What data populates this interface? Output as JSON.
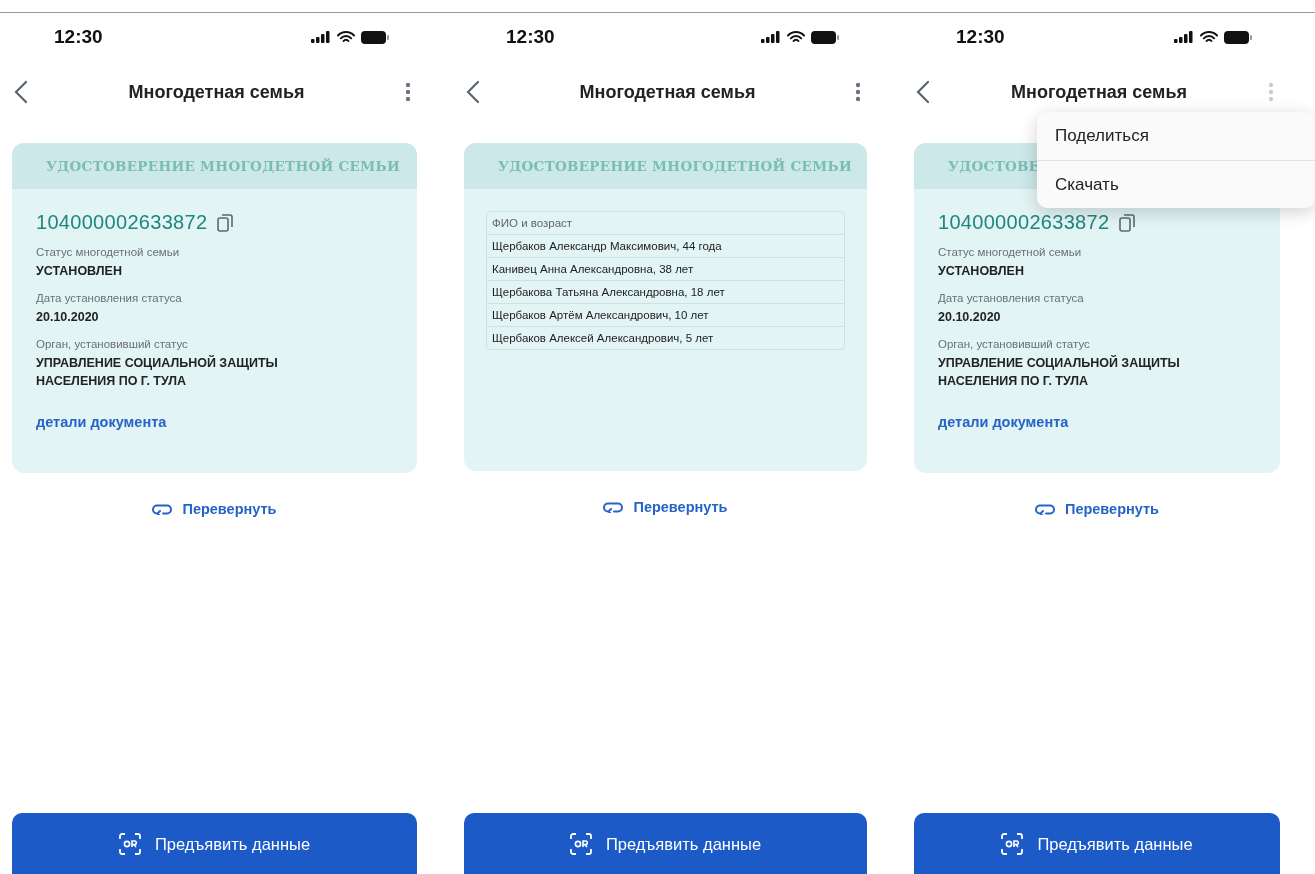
{
  "screens": [
    {
      "time": "12:30",
      "title": "Многодетная семья",
      "card": {
        "kind": "front",
        "header": "УДОСТОВЕРЕНИЕ МНОГОДЕТНОЙ СЕМЬИ",
        "number": "104000002633872",
        "fields": [
          {
            "label": "Статус многодетной семьи",
            "value": "УСТАНОВЛЕН"
          },
          {
            "label": "Дата установления статуса",
            "value": "20.10.2020"
          },
          {
            "label": "Орган, установивший статус",
            "value": "УПРАВЛЕНИЕ СОЦИАЛЬНОЙ ЗАЩИТЫ НАСЕЛЕНИЯ ПО Г. ТУЛА"
          }
        ],
        "details_link": "детали документа"
      },
      "flip_label": "Перевернуть",
      "button_label": "Предъявить данные"
    },
    {
      "time": "12:30",
      "title": "Многодетная семья",
      "card": {
        "kind": "back",
        "header": "УДОСТОВЕРЕНИЕ МНОГОДЕТНОЙ СЕМЬИ",
        "table_heading": "ФИО и возраст",
        "members": [
          "Щербаков Александр Максимович, 44 года",
          "Канивец Анна Александровна, 38 лет",
          "Щербакова Татьяна Александровна, 18 лет",
          "Щербаков Артём Александрович, 10 лет",
          "Щербаков Алексей Александрович, 5 лет"
        ]
      },
      "flip_label": "Перевернуть",
      "button_label": "Предъявить данные"
    },
    {
      "time": "12:30",
      "title": "Многодетная семья",
      "card": {
        "kind": "front",
        "header": "УДОСТОВЕ",
        "number": "104000002633872",
        "fields": [
          {
            "label": "Статус многодетной семьи",
            "value": "УСТАНОВЛЕН"
          },
          {
            "label": "Дата установления статуса",
            "value": "20.10.2020"
          },
          {
            "label": "Орган, установивший статус",
            "value": "УПРАВЛЕНИЕ СОЦИАЛЬНОЙ ЗАЩИТЫ НАСЕЛЕНИЯ ПО Г. ТУЛА"
          }
        ],
        "details_link": "детали документа"
      },
      "flip_label": "Перевернуть",
      "button_label": "Предъявить данные",
      "menu": [
        "Поделиться",
        "Скачать"
      ]
    }
  ]
}
